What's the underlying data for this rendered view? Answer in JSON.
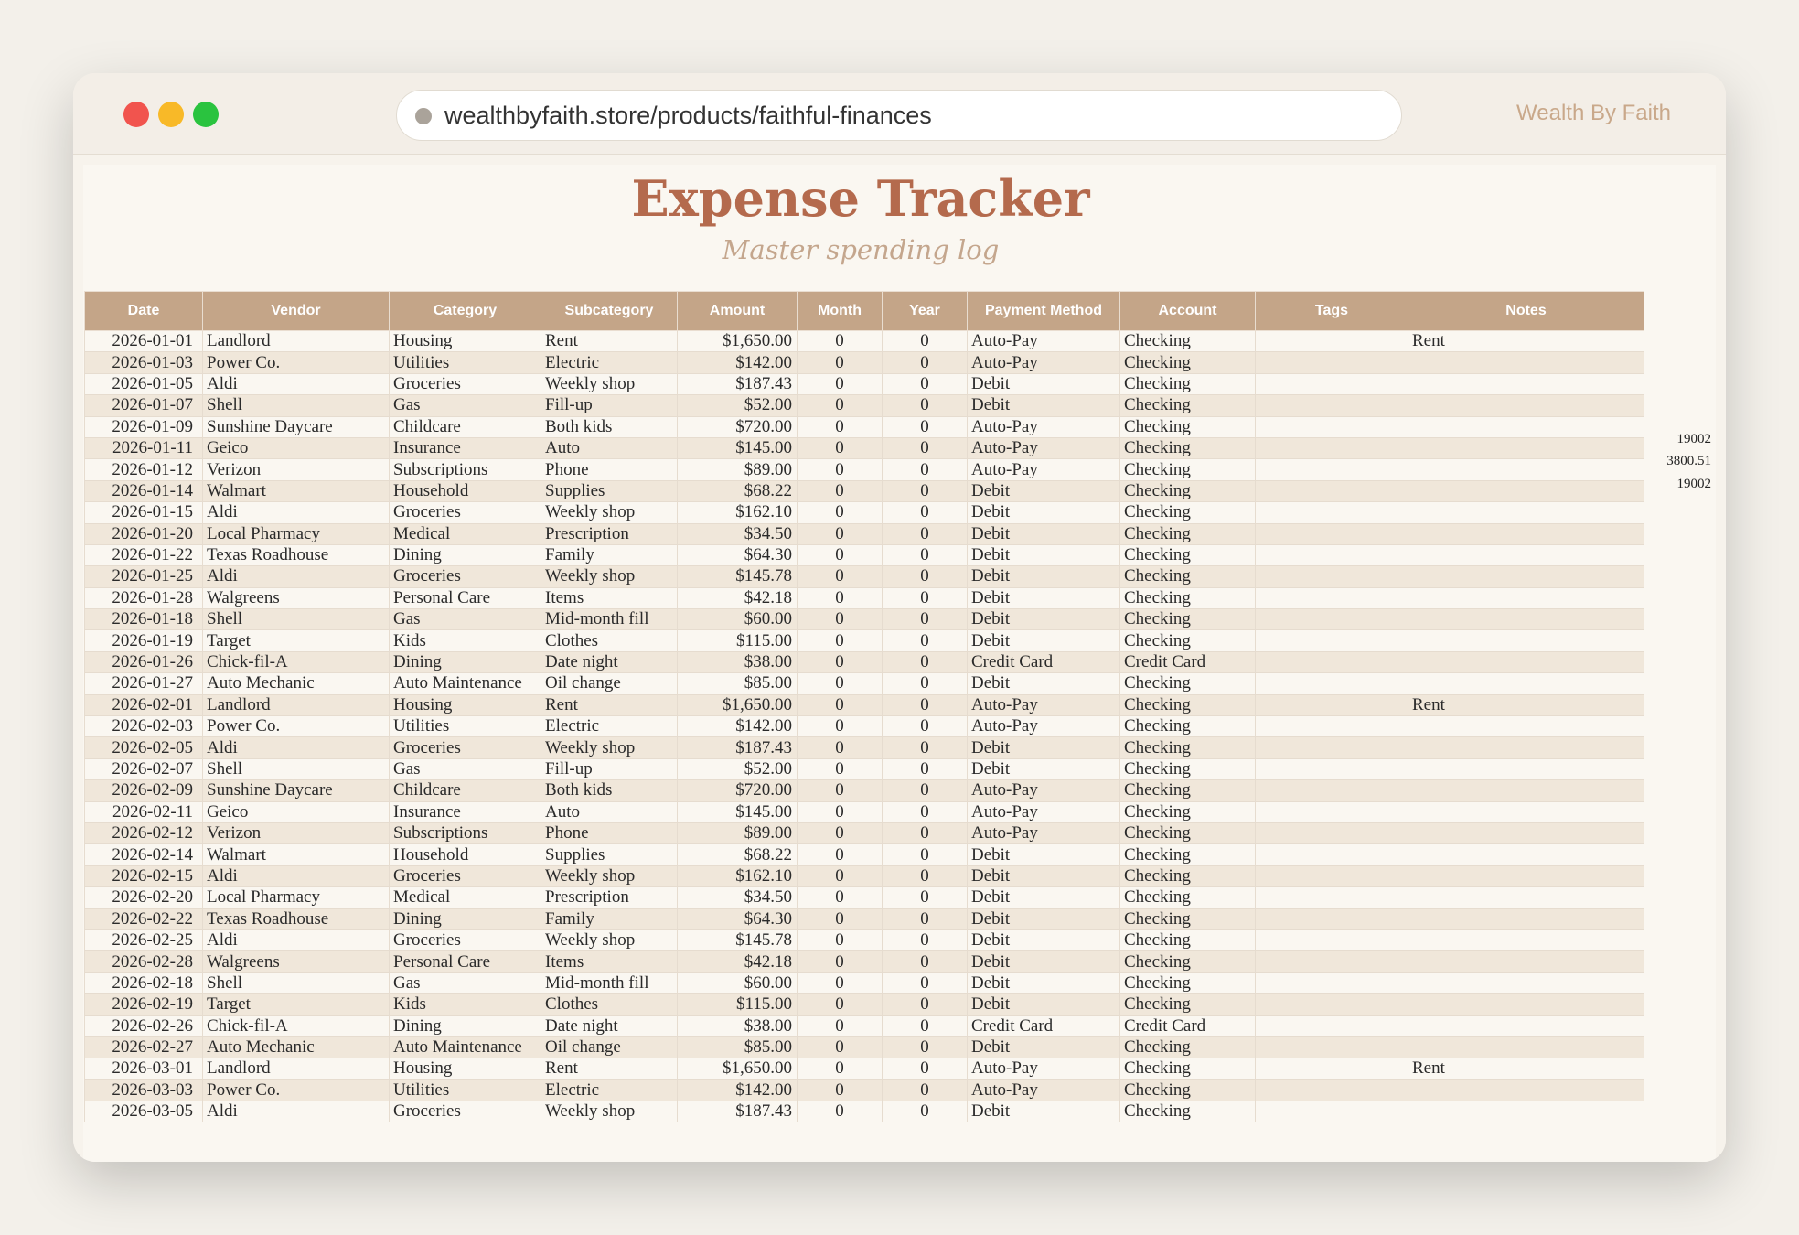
{
  "browser": {
    "url": "wealthbyfaith.store/products/faithful-finances",
    "brand": "Wealth By Faith"
  },
  "sheet": {
    "title": "Expense Tracker",
    "subtitle": "Master spending log",
    "columns": [
      "Date",
      "Vendor",
      "Category",
      "Subcategory",
      "Amount",
      "Month",
      "Year",
      "Payment Method",
      "Account",
      "Tags",
      "Notes"
    ],
    "side_values": [
      "19002",
      "3800.51",
      "19002"
    ],
    "rows": [
      [
        "2026-01-01",
        "Landlord",
        "Housing",
        "Rent",
        "$1,650.00",
        "0",
        "0",
        "Auto-Pay",
        "Checking",
        "",
        "Rent"
      ],
      [
        "2026-01-03",
        "Power Co.",
        "Utilities",
        "Electric",
        "$142.00",
        "0",
        "0",
        "Auto-Pay",
        "Checking",
        "",
        ""
      ],
      [
        "2026-01-05",
        "Aldi",
        "Groceries",
        "Weekly shop",
        "$187.43",
        "0",
        "0",
        "Debit",
        "Checking",
        "",
        ""
      ],
      [
        "2026-01-07",
        "Shell",
        "Gas",
        "Fill-up",
        "$52.00",
        "0",
        "0",
        "Debit",
        "Checking",
        "",
        ""
      ],
      [
        "2026-01-09",
        "Sunshine Daycare",
        "Childcare",
        "Both kids",
        "$720.00",
        "0",
        "0",
        "Auto-Pay",
        "Checking",
        "",
        ""
      ],
      [
        "2026-01-11",
        "Geico",
        "Insurance",
        "Auto",
        "$145.00",
        "0",
        "0",
        "Auto-Pay",
        "Checking",
        "",
        ""
      ],
      [
        "2026-01-12",
        "Verizon",
        "Subscriptions",
        "Phone",
        "$89.00",
        "0",
        "0",
        "Auto-Pay",
        "Checking",
        "",
        ""
      ],
      [
        "2026-01-14",
        "Walmart",
        "Household",
        "Supplies",
        "$68.22",
        "0",
        "0",
        "Debit",
        "Checking",
        "",
        ""
      ],
      [
        "2026-01-15",
        "Aldi",
        "Groceries",
        "Weekly shop",
        "$162.10",
        "0",
        "0",
        "Debit",
        "Checking",
        "",
        ""
      ],
      [
        "2026-01-20",
        "Local Pharmacy",
        "Medical",
        "Prescription",
        "$34.50",
        "0",
        "0",
        "Debit",
        "Checking",
        "",
        ""
      ],
      [
        "2026-01-22",
        "Texas Roadhouse",
        "Dining",
        "Family",
        "$64.30",
        "0",
        "0",
        "Debit",
        "Checking",
        "",
        ""
      ],
      [
        "2026-01-25",
        "Aldi",
        "Groceries",
        "Weekly shop",
        "$145.78",
        "0",
        "0",
        "Debit",
        "Checking",
        "",
        ""
      ],
      [
        "2026-01-28",
        "Walgreens",
        "Personal Care",
        "Items",
        "$42.18",
        "0",
        "0",
        "Debit",
        "Checking",
        "",
        ""
      ],
      [
        "2026-01-18",
        "Shell",
        "Gas",
        "Mid-month fill",
        "$60.00",
        "0",
        "0",
        "Debit",
        "Checking",
        "",
        ""
      ],
      [
        "2026-01-19",
        "Target",
        "Kids",
        "Clothes",
        "$115.00",
        "0",
        "0",
        "Debit",
        "Checking",
        "",
        ""
      ],
      [
        "2026-01-26",
        "Chick-fil-A",
        "Dining",
        "Date night",
        "$38.00",
        "0",
        "0",
        "Credit Card",
        "Credit Card",
        "",
        ""
      ],
      [
        "2026-01-27",
        "Auto Mechanic",
        "Auto Maintenance",
        "Oil change",
        "$85.00",
        "0",
        "0",
        "Debit",
        "Checking",
        "",
        ""
      ],
      [
        "2026-02-01",
        "Landlord",
        "Housing",
        "Rent",
        "$1,650.00",
        "0",
        "0",
        "Auto-Pay",
        "Checking",
        "",
        "Rent"
      ],
      [
        "2026-02-03",
        "Power Co.",
        "Utilities",
        "Electric",
        "$142.00",
        "0",
        "0",
        "Auto-Pay",
        "Checking",
        "",
        ""
      ],
      [
        "2026-02-05",
        "Aldi",
        "Groceries",
        "Weekly shop",
        "$187.43",
        "0",
        "0",
        "Debit",
        "Checking",
        "",
        ""
      ],
      [
        "2026-02-07",
        "Shell",
        "Gas",
        "Fill-up",
        "$52.00",
        "0",
        "0",
        "Debit",
        "Checking",
        "",
        ""
      ],
      [
        "2026-02-09",
        "Sunshine Daycare",
        "Childcare",
        "Both kids",
        "$720.00",
        "0",
        "0",
        "Auto-Pay",
        "Checking",
        "",
        ""
      ],
      [
        "2026-02-11",
        "Geico",
        "Insurance",
        "Auto",
        "$145.00",
        "0",
        "0",
        "Auto-Pay",
        "Checking",
        "",
        ""
      ],
      [
        "2026-02-12",
        "Verizon",
        "Subscriptions",
        "Phone",
        "$89.00",
        "0",
        "0",
        "Auto-Pay",
        "Checking",
        "",
        ""
      ],
      [
        "2026-02-14",
        "Walmart",
        "Household",
        "Supplies",
        "$68.22",
        "0",
        "0",
        "Debit",
        "Checking",
        "",
        ""
      ],
      [
        "2026-02-15",
        "Aldi",
        "Groceries",
        "Weekly shop",
        "$162.10",
        "0",
        "0",
        "Debit",
        "Checking",
        "",
        ""
      ],
      [
        "2026-02-20",
        "Local Pharmacy",
        "Medical",
        "Prescription",
        "$34.50",
        "0",
        "0",
        "Debit",
        "Checking",
        "",
        ""
      ],
      [
        "2026-02-22",
        "Texas Roadhouse",
        "Dining",
        "Family",
        "$64.30",
        "0",
        "0",
        "Debit",
        "Checking",
        "",
        ""
      ],
      [
        "2026-02-25",
        "Aldi",
        "Groceries",
        "Weekly shop",
        "$145.78",
        "0",
        "0",
        "Debit",
        "Checking",
        "",
        ""
      ],
      [
        "2026-02-28",
        "Walgreens",
        "Personal Care",
        "Items",
        "$42.18",
        "0",
        "0",
        "Debit",
        "Checking",
        "",
        ""
      ],
      [
        "2026-02-18",
        "Shell",
        "Gas",
        "Mid-month fill",
        "$60.00",
        "0",
        "0",
        "Debit",
        "Checking",
        "",
        ""
      ],
      [
        "2026-02-19",
        "Target",
        "Kids",
        "Clothes",
        "$115.00",
        "0",
        "0",
        "Debit",
        "Checking",
        "",
        ""
      ],
      [
        "2026-02-26",
        "Chick-fil-A",
        "Dining",
        "Date night",
        "$38.00",
        "0",
        "0",
        "Credit Card",
        "Credit Card",
        "",
        ""
      ],
      [
        "2026-02-27",
        "Auto Mechanic",
        "Auto Maintenance",
        "Oil change",
        "$85.00",
        "0",
        "0",
        "Debit",
        "Checking",
        "",
        ""
      ],
      [
        "2026-03-01",
        "Landlord",
        "Housing",
        "Rent",
        "$1,650.00",
        "0",
        "0",
        "Auto-Pay",
        "Checking",
        "",
        "Rent"
      ],
      [
        "2026-03-03",
        "Power Co.",
        "Utilities",
        "Electric",
        "$142.00",
        "0",
        "0",
        "Auto-Pay",
        "Checking",
        "",
        ""
      ],
      [
        "2026-03-05",
        "Aldi",
        "Groceries",
        "Weekly shop",
        "$187.43",
        "0",
        "0",
        "Debit",
        "Checking",
        "",
        ""
      ]
    ]
  }
}
